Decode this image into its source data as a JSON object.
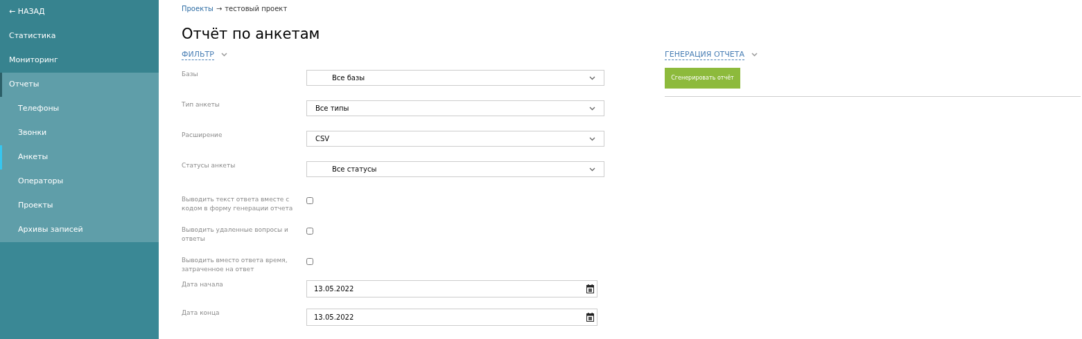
{
  "sidebar": {
    "back": "← НАЗАД",
    "items": [
      {
        "label": "Статистика",
        "selected": false
      },
      {
        "label": "Мониторинг",
        "selected": false
      },
      {
        "label": "Отчеты",
        "selected": false,
        "expanded": true,
        "children": [
          {
            "label": "Телефоны",
            "selected": false
          },
          {
            "label": "Звонки",
            "selected": false
          },
          {
            "label": "Анкеты",
            "selected": true
          },
          {
            "label": "Операторы",
            "selected": false
          },
          {
            "label": "Проекты",
            "selected": false
          },
          {
            "label": "Архивы записей",
            "selected": false
          }
        ]
      }
    ]
  },
  "breadcrumb": {
    "link": "Проекты",
    "separator": "→",
    "current": "тестовый проект"
  },
  "title": "Отчёт по анкетам",
  "filter": {
    "header": "ФИЛЬТР",
    "fields": [
      {
        "kind": "multiselect",
        "label": "Базы",
        "value": "Все базы"
      },
      {
        "kind": "select",
        "label": "Тип анкеты",
        "value": "Все типы"
      },
      {
        "kind": "select",
        "label": "Расширение",
        "value": "CSV"
      },
      {
        "kind": "multiselect",
        "label": "Статусы анкеты",
        "value": "Все статусы"
      },
      {
        "kind": "checkbox",
        "label": "Выводить текст ответа вместе с кодом в форму генерации отчета",
        "checked": false
      },
      {
        "kind": "checkbox",
        "label": "Выводить удаленные вопросы и ответы",
        "checked": false
      },
      {
        "kind": "checkbox",
        "label": "Выводить вместо ответа время, затраченное на ответ",
        "checked": false
      },
      {
        "kind": "date",
        "label": "Дата начала",
        "value": "13.05.2022"
      },
      {
        "kind": "date",
        "label": "Дата конца",
        "value": "13.05.2022"
      }
    ]
  },
  "generation": {
    "header": "ГЕНЕРАЦИЯ ОТЧЕТА",
    "button": "Сгенерировать отчёт"
  }
}
